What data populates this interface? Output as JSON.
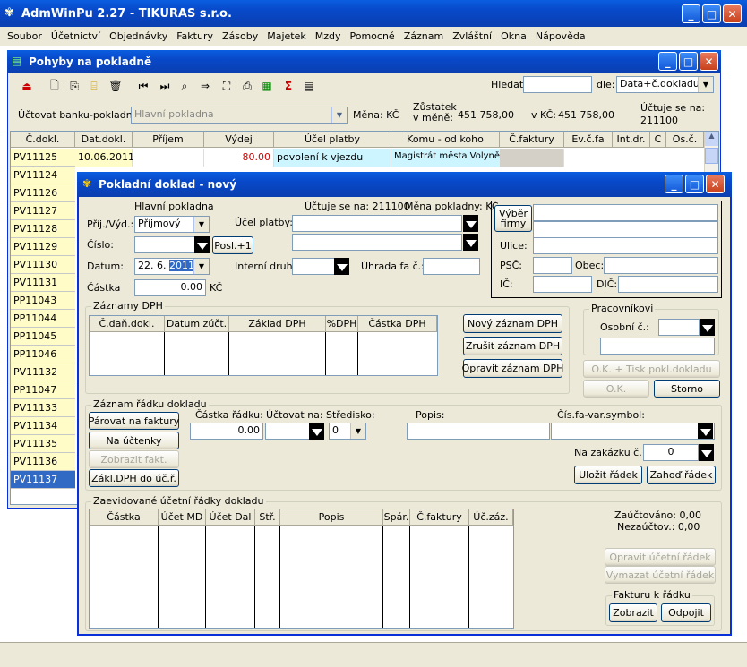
{
  "app": {
    "title": "AdmWinPu 2.27 - TIKURAS  s.r.o."
  },
  "menu": [
    "Soubor",
    "Účetnictví",
    "Objednávky",
    "Faktury",
    "Zásoby",
    "Majetek",
    "Mzdy",
    "Pomocné",
    "Záznam",
    "Zvláštní",
    "Okna",
    "Nápověda"
  ],
  "pohyby": {
    "title": "Pohyby na pokladně",
    "hledat_label": "Hledat:",
    "hledat_value": "",
    "dle_label": "dle:",
    "dle_value": "Data+č.dokladu",
    "ucet_label": "Účtovat banku-pokladnu:",
    "ucet_value": "Hlavní pokladna",
    "mena_label": "Měna: KČ",
    "zustatek_label": "Zůstatek v měně:",
    "zustatek_value": "451 758,00",
    "vkc_label": "v KČ:",
    "vkc_value": "451 758,00",
    "uctuje_label": "Účtuje se na:",
    "uctuje_value": "211100",
    "columns": [
      "Č.dokl.",
      "Dat.dokl.",
      "Příjem",
      "Výdej",
      "Účel platby",
      "Komu - od koho",
      "Č.faktury",
      "Ev.č.fa",
      "Int.dr.",
      "C",
      "Os.č."
    ],
    "first_row": {
      "doc": "PV11125",
      "date": "10.06.2011",
      "prijem": "",
      "vydej": "80.00",
      "ucel": "povolení k vjezdu",
      "komu": "Magistrát města Volyně"
    },
    "rows": [
      "PV11124",
      "PV11126",
      "PV11127",
      "PV11128",
      "PV11129",
      "PV11130",
      "PV11131",
      "PP11043",
      "PP11044",
      "PP11045",
      "PP11046",
      "PV11132",
      "PP11047",
      "PV11133",
      "PV11134",
      "PV11135",
      "PV11136",
      "PV11137"
    ]
  },
  "dialog": {
    "title": "Pokladní doklad - nový",
    "pokladna": "Hlavní pokladna",
    "uctuje": "Účtuje se na: 211100",
    "mena": "Měna pokladny: KČ",
    "prij_vyd_label": "Příj./Výd.:",
    "prij_vyd_value": "Příjmový",
    "cislo_label": "Číslo:",
    "cislo_value": "",
    "posl_btn": "Posl.+1",
    "datum_label": "Datum:",
    "datum_value_a": "22. 6. ",
    "datum_value_b": "2011",
    "castka_label": "Částka",
    "castka_value": "0.00",
    "castka_unit": "KČ",
    "ucel_label": "Účel platby:",
    "interni_label": "Interní druh:",
    "uhrada_label": "Úhrada fa č.:",
    "vyber_btn": "Výběr firmy",
    "ulice_label": "Ulice:",
    "psc_label": "PSČ:",
    "obec_label": "Obec:",
    "ic_label": "IČ:",
    "dic_label": "DIČ:",
    "dph_group": "Záznamy DPH",
    "dph_cols": [
      "Č.daň.dokl.",
      "Datum zúčt.",
      "Základ DPH",
      "%DPH",
      "Částka DPH"
    ],
    "novy_dph": "Nový záznam DPH",
    "zrusit_dph": "Zrušit záznam DPH",
    "opravit_dph": "Opravit záznam DPH",
    "prac_group": "Pracovníkovi",
    "osobni_label": "Osobní č.:",
    "ok_tisk": "O.K. + Tisk pokl.dokladu",
    "ok": "O.K.",
    "storno": "Storno",
    "radek_group": "Záznam řádku dokladu",
    "parovat": "Párovat na faktury",
    "na_uctenky": "Na účtenky",
    "zobrazit_fakt": "Zobrazit fakt.",
    "zakl_dph": "Zákl.DPH do úč.ř.",
    "castka_radku_label": "Částka řádku:",
    "castka_radku_value": "0.00",
    "uctovat_na_label": "Účtovat na:",
    "stredisko_label": "Středisko:",
    "stredisko_value": "0",
    "popis_label": "Popis:",
    "cis_fa_label": "Čís.fa-var.symbol:",
    "zakazka_label": "Na zakázku č.:",
    "zakazka_value": "0",
    "ulozit": "Uložit řádek",
    "zahod": "Zahoď řádek",
    "zaev_group": "Zaevidované účetní řádky dokladu",
    "zaev_cols": [
      "Částka",
      "Účet MD",
      "Účet Dal",
      "Stř.",
      "Popis",
      "Spár.",
      "Č.faktury",
      "Úč.záz."
    ],
    "zauctovano": "Zaúčtováno: 0,00",
    "nezauctov": "Nezaúčtov.: 0,00",
    "opravit_uct": "Opravit účetní řádek",
    "vymazat_uct": "Vymazat účetní řádek",
    "fakturu_group": "Fakturu k řádku",
    "zobrazit": "Zobrazit",
    "odpojit": "Odpojit"
  }
}
